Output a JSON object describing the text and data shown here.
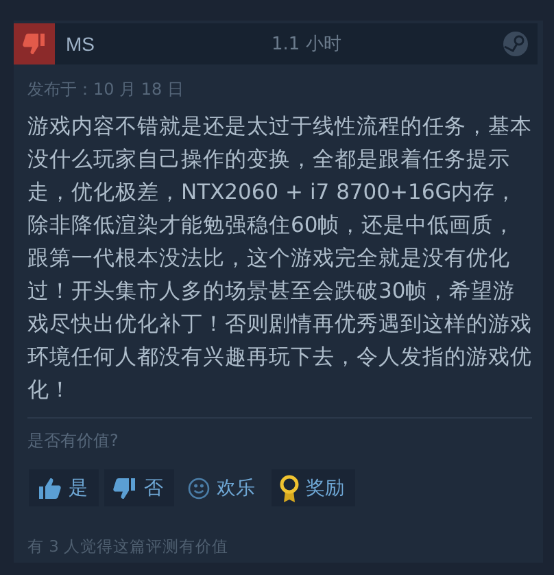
{
  "review": {
    "recommended": false,
    "author": "MS",
    "playtime": "1.1 小时",
    "posted": "发布于：10 月 18 日",
    "body": "游戏内容不错就是还是太过于线性流程的任务，基本没什么玩家自己操作的变换，全都是跟着任务提示走，优化极差，NTX2060 + i7 8700+16G内存，除非降低渲染才能勉强稳住60帧，还是中低画质，跟第一代根本没法比，这个游戏完全就是没有优化过！开头集市人多的场景甚至会跌破30帧，希望游戏尽快出优化补丁！否则剧情再优秀遇到这样的游戏环境任何人都没有兴趣再玩下去，令人发指的游戏优化！",
    "question": "是否有价值?",
    "buttons": [
      {
        "kind": "yes",
        "label": "是"
      },
      {
        "kind": "no",
        "label": "否"
      },
      {
        "kind": "funny",
        "label": "欢乐"
      },
      {
        "kind": "award",
        "label": "奖励"
      }
    ],
    "helpful": "有 3 人觉得这篇评测有价值"
  }
}
